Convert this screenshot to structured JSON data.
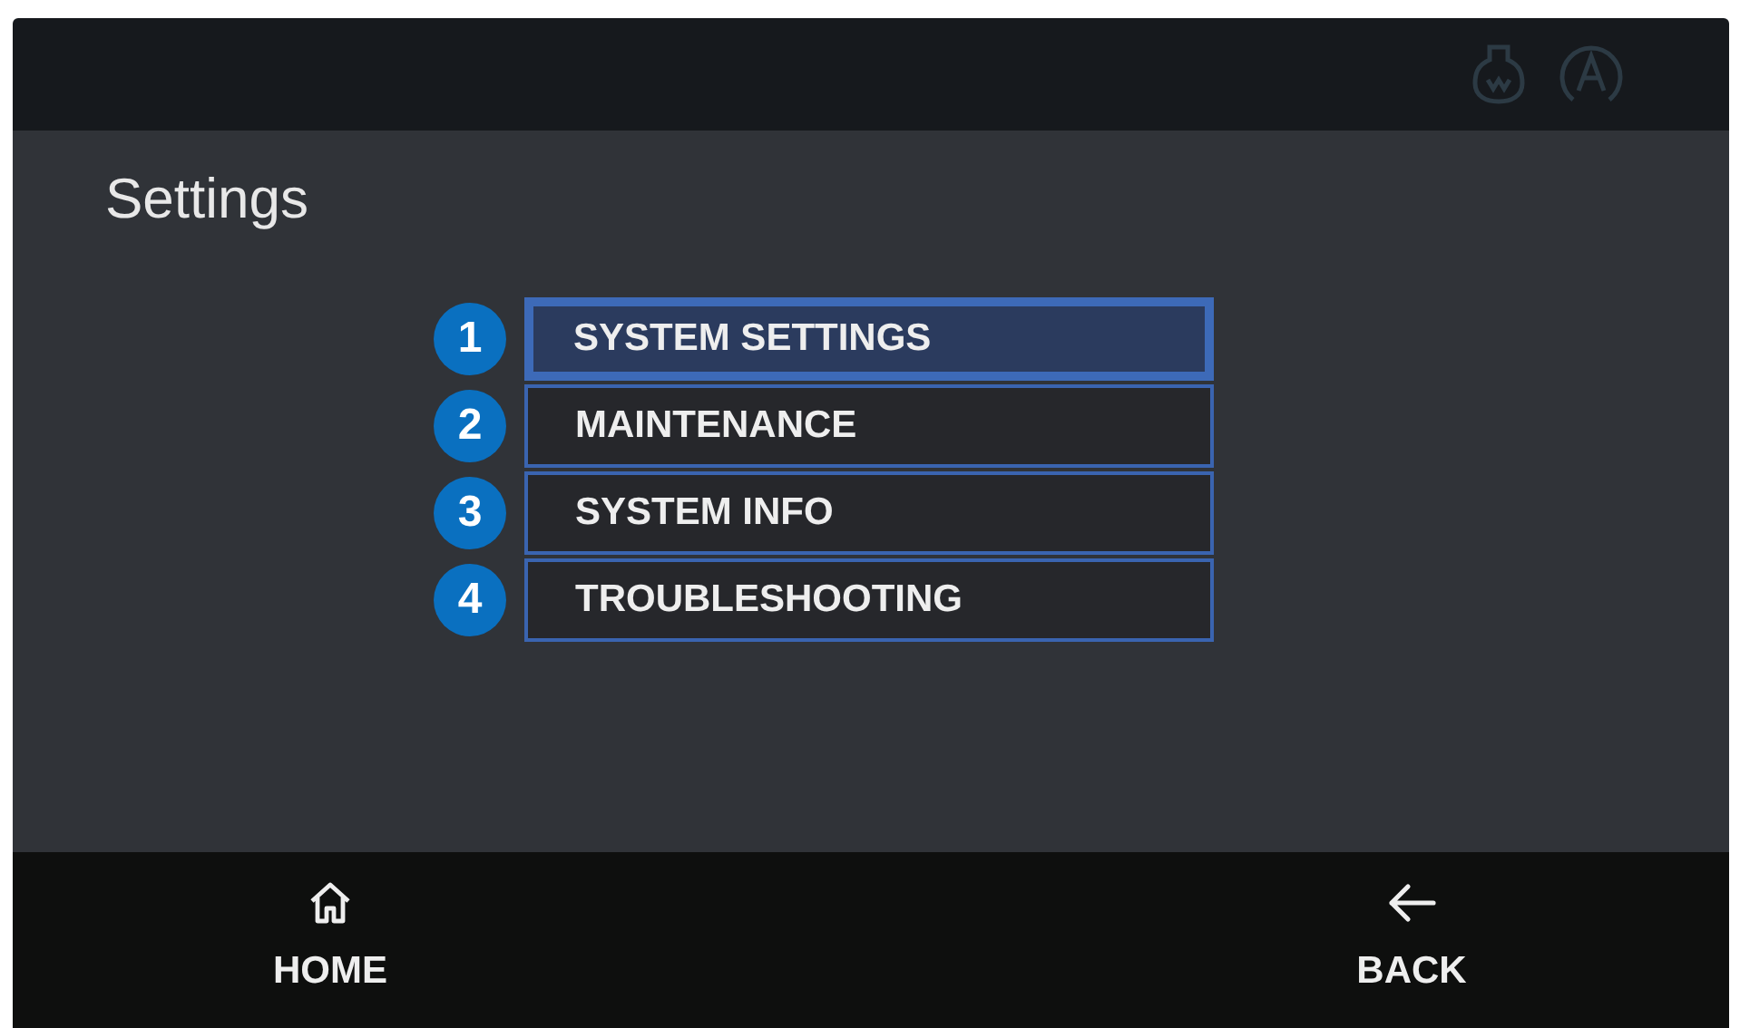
{
  "title": "Settings",
  "menu": [
    {
      "number": "1",
      "label": "SYSTEM SETTINGS",
      "selected": true
    },
    {
      "number": "2",
      "label": "MAINTENANCE",
      "selected": false
    },
    {
      "number": "3",
      "label": "SYSTEM INFO",
      "selected": false
    },
    {
      "number": "4",
      "label": "TROUBLESHOOTING",
      "selected": false
    }
  ],
  "nav": [
    {
      "kind": "home",
      "label": "HOME"
    },
    {
      "kind": "back",
      "label": "BACK"
    }
  ]
}
